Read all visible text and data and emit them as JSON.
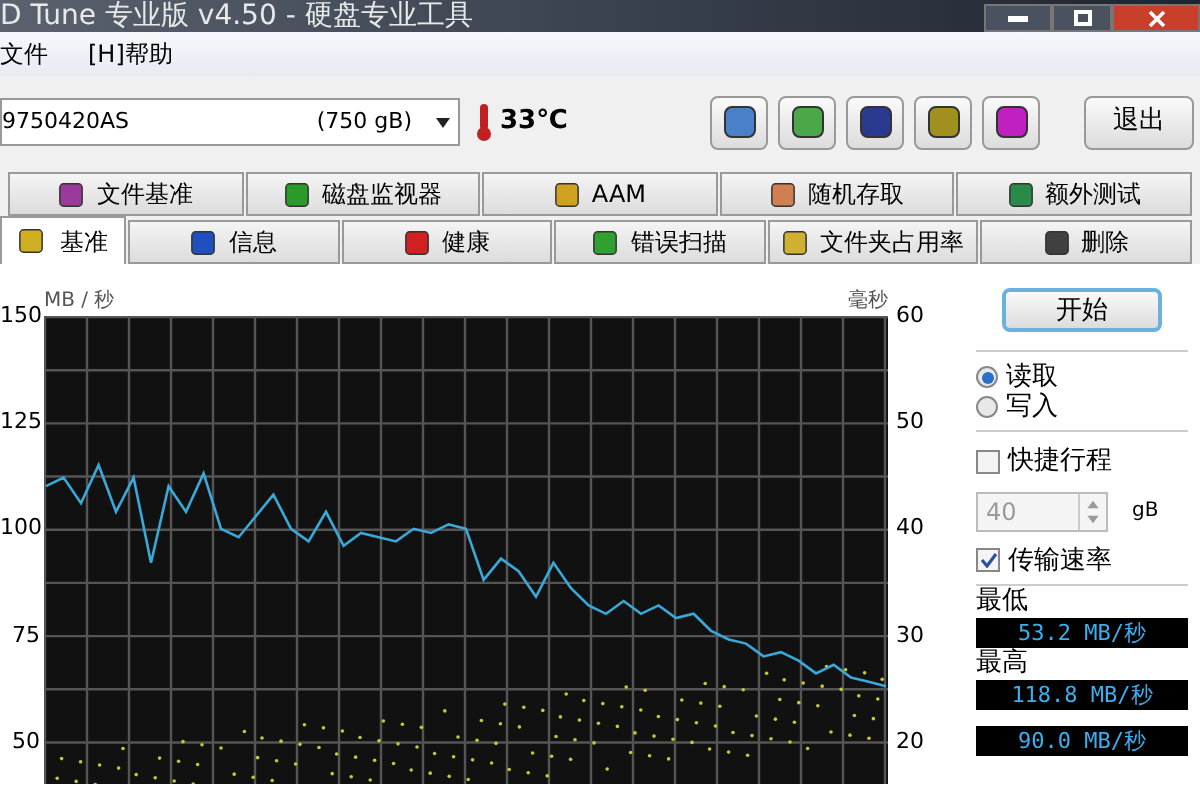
{
  "window": {
    "title": "D Tune 专业版 v4.50 - 硬盘专业工具"
  },
  "menu": [
    "文件",
    "[H]帮助"
  ],
  "toolbar": {
    "drive": "9750420AS",
    "capacity": "(750 gB)",
    "temperature": "33℃",
    "exit_button": "退出"
  },
  "tabs_top": [
    {
      "label": "文件基准",
      "selected": false
    },
    {
      "label": "磁盘监视器",
      "selected": false
    },
    {
      "label": "AAM",
      "selected": false
    },
    {
      "label": "随机存取",
      "selected": false
    },
    {
      "label": "额外测试",
      "selected": false
    }
  ],
  "tabs_bottom": [
    {
      "label": "基准",
      "selected": true
    },
    {
      "label": "信息",
      "selected": false
    },
    {
      "label": "健康",
      "selected": false
    },
    {
      "label": "错误扫描",
      "selected": false
    },
    {
      "label": "文件夹占用率",
      "selected": false
    },
    {
      "label": "删除",
      "selected": false
    }
  ],
  "chart": {
    "right_unit": "毫秒",
    "right_ticks": [
      "60",
      "50",
      "40",
      "30",
      "20"
    ],
    "chart_data": {
      "type": "line",
      "grid": true,
      "ylabel": "MB / 秒",
      "ylim": [
        40,
        150
      ],
      "yticks": [
        150,
        125,
        100,
        75,
        50
      ],
      "series": [
        {
          "color": "#3aa8d8",
          "values": [
            110,
            112,
            106,
            115,
            104,
            112,
            92,
            110,
            104,
            113,
            100,
            98,
            103,
            108,
            100,
            97,
            104,
            96,
            99,
            98,
            97,
            100,
            99,
            101,
            100,
            88,
            93,
            90,
            84,
            92,
            86,
            82,
            80,
            83,
            80,
            82,
            79,
            80,
            76,
            74,
            73,
            70,
            71,
            69,
            66,
            68,
            65,
            64,
            63
          ]
        }
      ]
    }
  },
  "panel": {
    "start_button": "开始",
    "modes": [
      {
        "label": "读取",
        "selected": true
      },
      {
        "label": "写入",
        "selected": false
      }
    ],
    "quick": {
      "label": "快捷行程",
      "checked": false
    },
    "size": {
      "value": "40",
      "unit": "gB",
      "disabled": true
    },
    "transfer": {
      "label": "传输速率",
      "checked": true
    },
    "stats": [
      {
        "label": "最低",
        "value": "53.2 MB/秒"
      },
      {
        "label": "最高",
        "value": "118.8 MB/秒"
      },
      {
        "value": "90.0 MB/秒"
      }
    ]
  }
}
